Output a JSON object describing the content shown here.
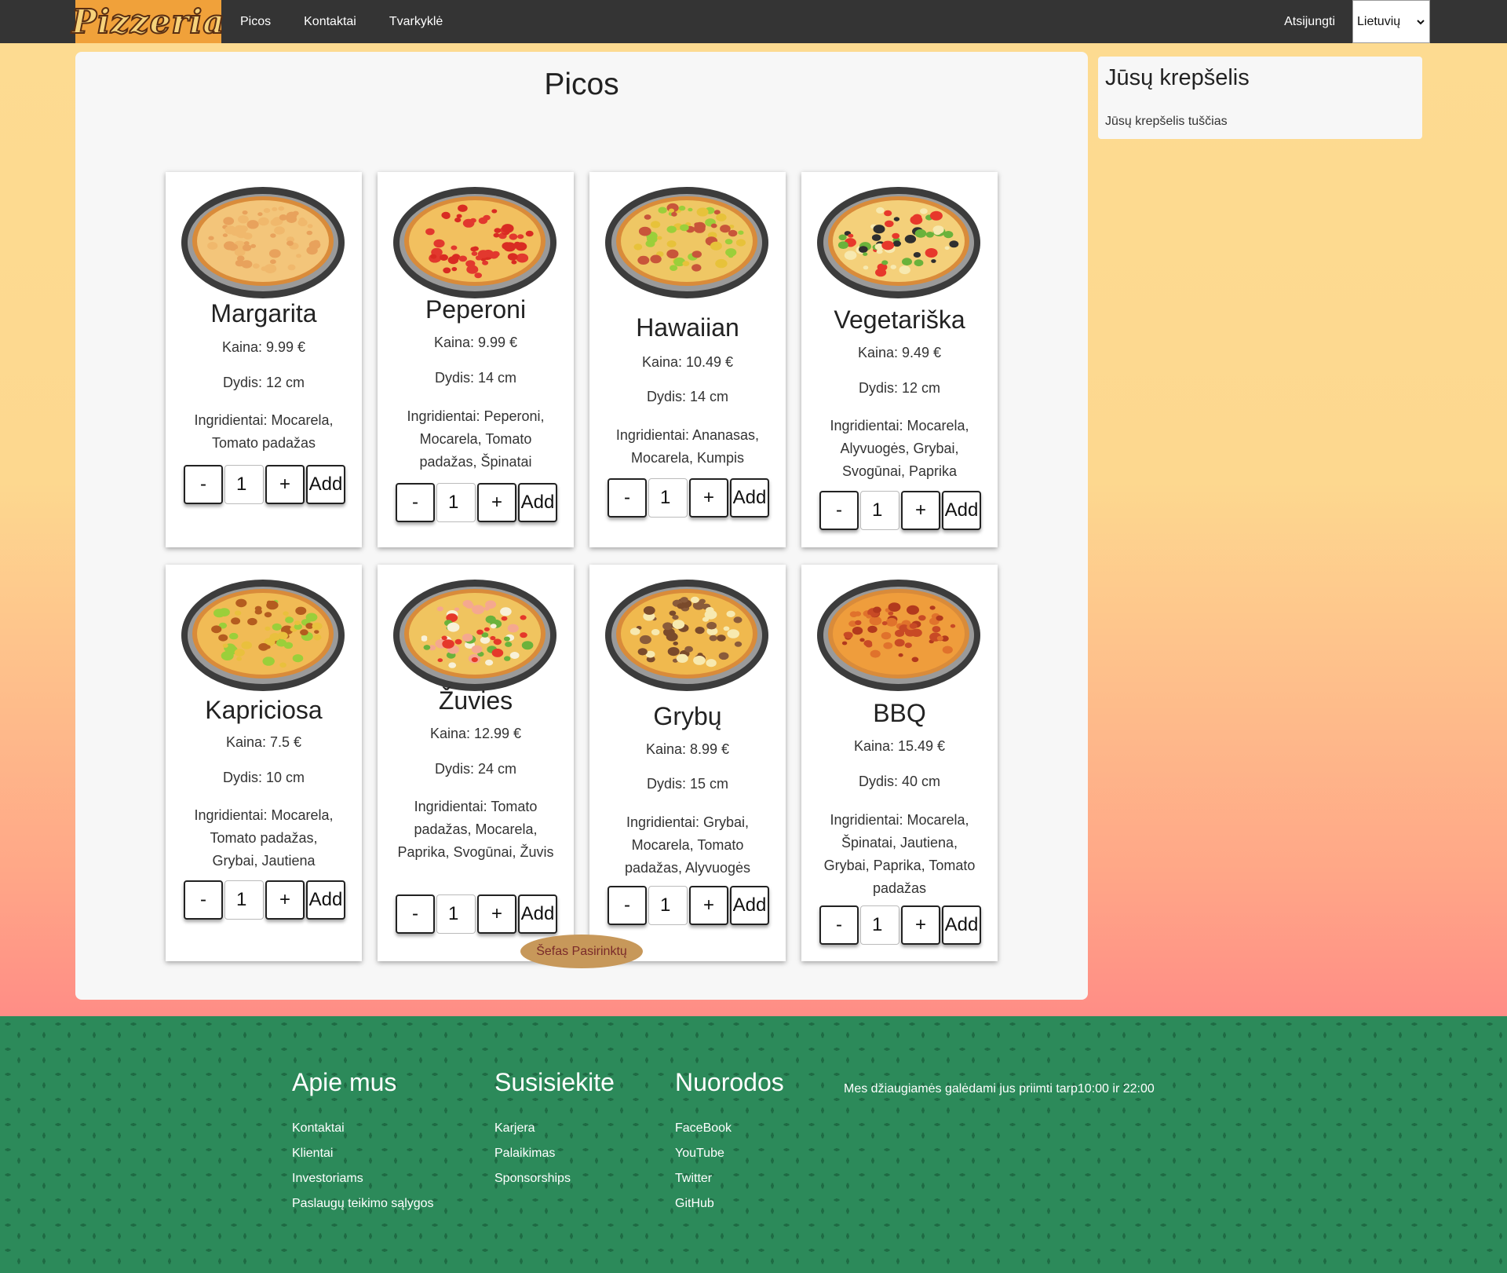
{
  "navbar": {
    "logo_text": "Pizzeria",
    "links": [
      "Picos",
      "Kontaktai",
      "Tvarkyklė"
    ],
    "logout_label": "Atsijungti",
    "language": "Lietuvių"
  },
  "main": {
    "title": "Picos",
    "add_label": "Add",
    "minus_label": "-",
    "plus_label": "+",
    "pizzas": [
      {
        "name": "Margarita",
        "price": "Kaina: 9.99 €",
        "size": "Dydis: 12 cm",
        "ingredients": "Ingridientai: Mocarela, Tomato padažas",
        "qty": "1"
      },
      {
        "name": "Peperoni",
        "price": "Kaina: 9.99 €",
        "size": "Dydis: 14 cm",
        "ingredients": "Ingridientai: Peperoni, Mocarela, Tomato padažas, Špinatai",
        "qty": "1"
      },
      {
        "name": "Hawaiian",
        "price": "Kaina: 10.49 €",
        "size": "Dydis: 14 cm",
        "ingredients": "Ingridientai: Ananasas, Mocarela, Kumpis",
        "qty": "1"
      },
      {
        "name": "Vegetariška",
        "price": "Kaina: 9.49 €",
        "size": "Dydis: 12 cm",
        "ingredients": "Ingridientai: Mocarela, Alyvuogės, Grybai, Svogūnai, Paprika",
        "qty": "1"
      },
      {
        "name": "Kapriciosa",
        "price": "Kaina: 7.5 €",
        "size": "Dydis: 10 cm",
        "ingredients": "Ingridientai: Mocarela, Tomato padažas, Grybai, Jautiena",
        "qty": "1"
      },
      {
        "name": "Žuvies",
        "price": "Kaina: 12.99 €",
        "size": "Dydis: 24 cm",
        "ingredients": "Ingridientai: Tomato padažas, Mocarela, Paprika, Svogūnai, Žuvis",
        "qty": "1"
      },
      {
        "name": "Grybų",
        "price": "Kaina: 8.99 €",
        "size": "Dydis: 15 cm",
        "ingredients": "Ingridientai: Grybai, Mocarela, Tomato padažas, Alyvuogės",
        "qty": "1"
      },
      {
        "name": "BBQ",
        "price": "Kaina: 15.49 €",
        "size": "Dydis: 40 cm",
        "ingredients": "Ingridientai: Mocarela, Špinatai, Jautiena, Grybai, Paprika, Tomato padažas",
        "qty": "1"
      }
    ],
    "chef_button": "Šefas Pasirinktų"
  },
  "cart": {
    "title": "Jūsų krepšelis",
    "empty_text": "Jūsų krepšelis tuščias"
  },
  "footer": {
    "columns": [
      {
        "heading": "Apie mus",
        "links": [
          "Kontaktai",
          "Klientai",
          "Investoriams",
          "Paslaugų teikimo sąlygos"
        ]
      },
      {
        "heading": "Susisiekite",
        "links": [
          "Karjera",
          "Palaikimas",
          "Sponsorships"
        ]
      },
      {
        "heading": "Nuorodos",
        "links": [
          "FaceBook",
          "YouTube",
          "Twitter",
          "GitHub"
        ]
      }
    ],
    "hours_text": "Mes džiaugiamės galėdami jus priimti tarp10:00 ir 22:00"
  },
  "colors": {
    "navbar": "#343434",
    "logo_bg": "#f0a13a",
    "gradient_top": "#fddb91",
    "gradient_bottom": "#ff8d86",
    "footer": "#2c8a5a",
    "chef_button": "#c7985a"
  },
  "icons": {
    "language_dropdown": "chevron-down-icon"
  }
}
